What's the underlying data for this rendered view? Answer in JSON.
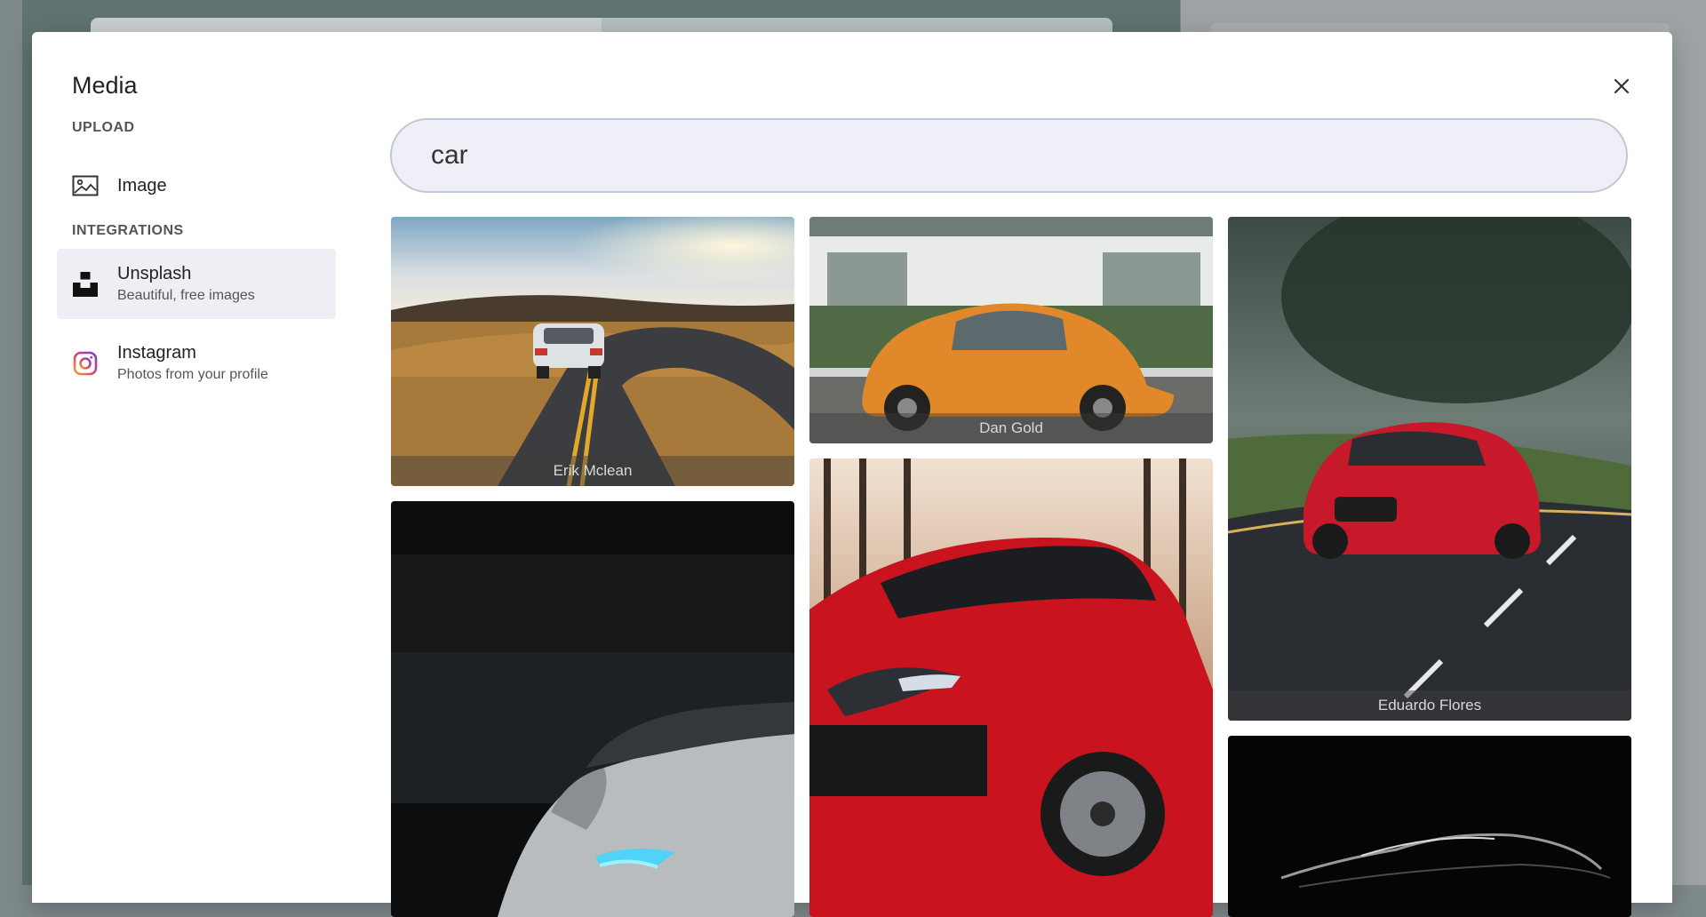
{
  "modal": {
    "title": "Media",
    "close_icon": "close-icon"
  },
  "sidebar": {
    "upload_label": "UPLOAD",
    "upload_items": [
      {
        "icon": "image-icon",
        "title": "Image"
      }
    ],
    "integrations_label": "INTEGRATIONS",
    "integration_items": [
      {
        "icon": "unsplash-icon",
        "title": "Unsplash",
        "subtitle": "Beautiful, free images",
        "active": true
      },
      {
        "icon": "instagram-icon",
        "title": "Instagram",
        "subtitle": "Photos from your profile",
        "active": false
      }
    ]
  },
  "search": {
    "value": "car"
  },
  "results": [
    {
      "credit": "Erik Mclean",
      "subject": "white sports car on winding road at sunset"
    },
    {
      "credit": "Dan Gold",
      "subject": "orange vintage beetle"
    },
    {
      "credit": "Eduardo Flores",
      "subject": "red sports car on road"
    },
    {
      "credit": "",
      "subject": "dark car with blue headlight"
    },
    {
      "credit": "",
      "subject": "red hatchback front"
    },
    {
      "credit": "",
      "subject": "car silhouette on black"
    }
  ],
  "colors": {
    "accent_bg": "#eeeef4",
    "search_border": "#c1c7da",
    "search_bg": "#eff0f7"
  }
}
